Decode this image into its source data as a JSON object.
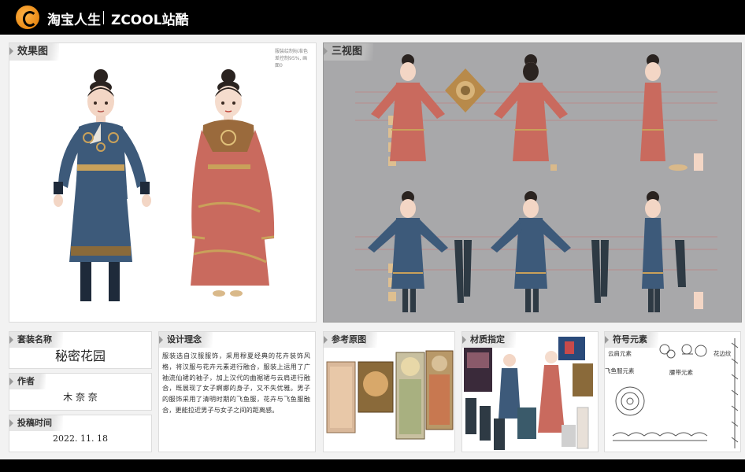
{
  "header": {
    "brand_taobao": "淘宝人生",
    "brand_zcool": "ZCOOL站酷"
  },
  "panels": {
    "effect": {
      "title": "效果图",
      "note": "服装绘制标准色差控制95%, 画面0"
    },
    "three_view": {
      "title": "三视图"
    },
    "outfit_name": {
      "title": "套装名称",
      "value": "秘密花园"
    },
    "author": {
      "title": "作者",
      "value": "木 奈 奈"
    },
    "submit_time": {
      "title": "投稿时间",
      "value": "2022. 11. 18"
    },
    "design_concept": {
      "title": "设计理念",
      "text": "服装选自汉服服饰，采用穆夏经典的花卉装饰风格，将汉服与花卉元素进行融合，服装上运用了广袖流仙裙的袖子，加上汉代的曲裾裙与云肩进行融合，既展现了女子婀娜的身子，又不失优雅。男子的服饰采用了清明时期的飞鱼服，花卉与飞鱼服融合，更能拉近男子与女子之间的距离感。"
    },
    "reference": {
      "title": "参考原图"
    },
    "material": {
      "title": "材质指定"
    },
    "symbols": {
      "title": "符号元素",
      "labels": [
        "云肩元素",
        "花边纹",
        "飞鱼服元素",
        "腰带元素"
      ]
    }
  },
  "colors": {
    "male_outfit": "#3d5a7a",
    "female_outfit": "#c96a5e",
    "gold_trim": "#c9a15a",
    "grey_bg": "#a8a8aa"
  }
}
